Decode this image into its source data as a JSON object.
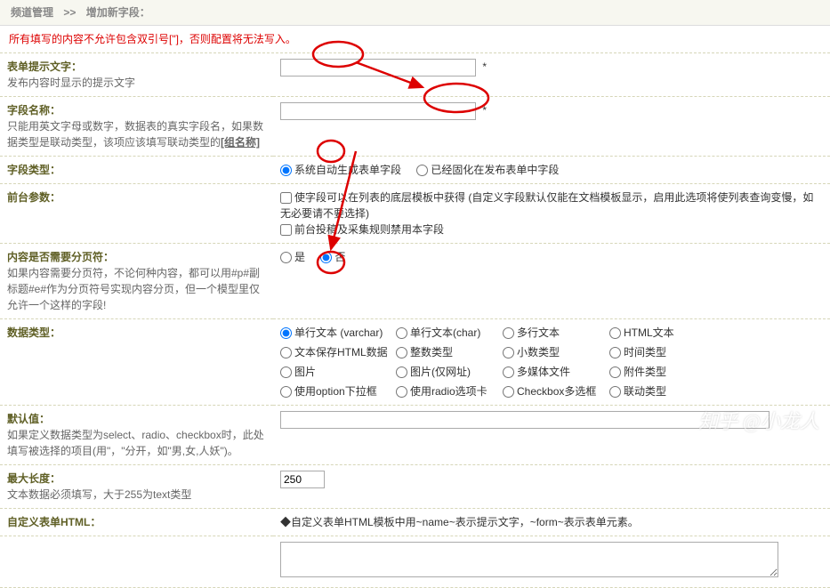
{
  "crumb": {
    "a": "频道管理",
    "sep": ">>",
    "b": "增加新字段："
  },
  "warn": "所有填写的内容不允许包含双引号[\"]，否则配置将无法写入。",
  "r1": {
    "t": "表单提示文字：",
    "d": "发布内容时显示的提示文字",
    "star": "*"
  },
  "r2": {
    "t": "字段名称：",
    "d1": "只能用英文字母或数字，数据表的真实字段名，如果数据类型是联动类型，该项应该填写联动类型的",
    "d2": "[组名称]",
    "star": "*"
  },
  "r3": {
    "t": "字段类型：",
    "o1": "系统自动生成表单字段",
    "o2": "已经固化在发布表单中字段"
  },
  "r4": {
    "t": "前台参数：",
    "c1": "使字段可以在列表的底层模板中获得 (自定义字段默认仅能在文档模板显示，启用此选项将使列表查询变慢，如无必要请不要选择)",
    "c2": "前台投稿及采集规则禁用本字段"
  },
  "r5": {
    "t": "内容是否需要分页符：",
    "d": "如果内容需要分页符，不论何种内容，都可以用#p#副标题#e#作为分页符号实现内容分页，但一个模型里仅允许一个这样的字段!",
    "o1": "是",
    "o2": "否"
  },
  "r6": {
    "t": "数据类型：",
    "g": [
      [
        "单行文本 (varchar)",
        "单行文本(char)",
        "多行文本",
        "HTML文本",
        ""
      ],
      [
        "文本保存HTML数据",
        "整数类型",
        "小数类型",
        "时间类型",
        ""
      ],
      [
        "图片",
        "图片(仅网址)",
        "多媒体文件",
        "附件类型",
        ""
      ],
      [
        "使用option下拉框",
        "使用radio选项卡",
        "Checkbox多选框",
        "联动类型",
        ""
      ]
    ]
  },
  "r7": {
    "t": "默认值：",
    "d": "如果定义数据类型为select、radio、checkbox时，此处填写被选择的项目(用\"，\"分开，如\"男,女,人妖\")。"
  },
  "r8": {
    "t": "最大长度：",
    "d": "文本数据必须填写，大于255为text类型",
    "v": "250"
  },
  "r9": {
    "t": "自定义表单HTML：",
    "d": "◆自定义表单HTML模板中用~name~表示提示文字，~form~表示表单元素。"
  },
  "wm": "知乎 @小龙人"
}
